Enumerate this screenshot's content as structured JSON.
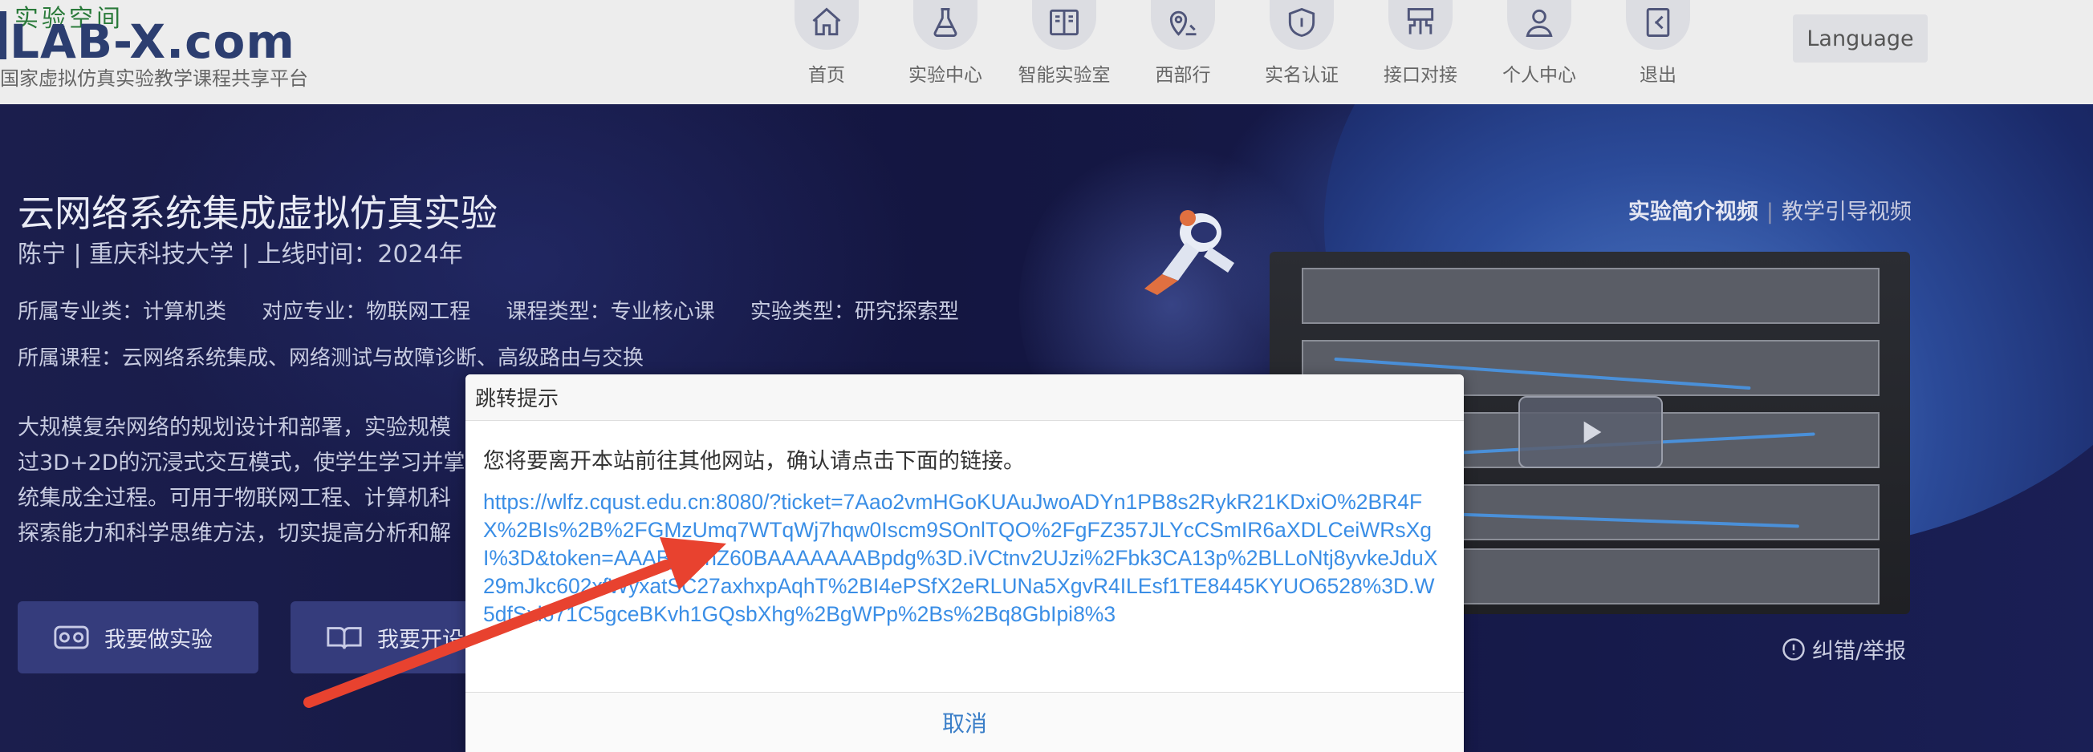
{
  "header": {
    "logo_top": "实验空间",
    "logo_main": "LAB-X.com",
    "logo_sub": "国家虚拟仿真实验教学课程共享平台",
    "nav": [
      {
        "label": "首页",
        "icon": "home-icon"
      },
      {
        "label": "实验中心",
        "icon": "flask-icon"
      },
      {
        "label": "智能实验室",
        "icon": "book-icon"
      },
      {
        "label": "西部行",
        "icon": "map-pin-icon"
      },
      {
        "label": "实名认证",
        "icon": "shield-icon"
      },
      {
        "label": "接口对接",
        "icon": "interface-icon"
      },
      {
        "label": "个人中心",
        "icon": "user-icon"
      },
      {
        "label": "退出",
        "icon": "logout-icon"
      }
    ],
    "language_label": "Language"
  },
  "experiment": {
    "title": "云网络系统集成虚拟仿真实验",
    "meta": "陈宁 | 重庆科技大学 | 上线时间：2024年",
    "tags": [
      "所属专业类：计算机类",
      "对应专业：物联网工程",
      "课程类型：专业核心课",
      "实验类型：研究探索型"
    ],
    "courses": "所属课程：云网络系统集成、网络测试与故障诊断、高级路由与交换",
    "description_lines": [
      "大规模复杂网络的规划设计和部署，实验规模",
      "过3D+2D的沉浸式交互模式，使学生学习并掌",
      "统集成全过程。可用于物联网工程、计算机科",
      "探索能力和科学思维方法，切实提高分析和解"
    ],
    "btn_do": "我要做实验",
    "btn_open": "我要开设"
  },
  "video": {
    "intro_label": "实验简介视频",
    "separator": "|",
    "guide_label": "教学引导视频",
    "report_label": "纠错/举报"
  },
  "modal": {
    "title": "跳转提示",
    "message": "您将要离开本站前往其他网站，确认请点击下面的链接。",
    "link": "https://wlfz.cqust.edu.cn:8080/?ticket=7Aao2vmHGoKUAuJwoADYn1PB8s2RykR21KDxiO%2BR4FX%2BIs%2B%2FGMzUmq7WTqWj7hqw0Iscm9SOnlTQO%2FgFZ357JLYcCSmIR6aXDLCeiWRsXgI%3D&token=AAABjhmhZ60BAAAAAAABpdg%3D.iVCtnv2UJzi%2Fbk3CA13p%2BLLoNtj8yvkeJduX29mJkc602xfWyxatSC27axhxpAqhT%2BI4ePSfX2eRLUNa5XgvR4ILEsf1TE8445KYUO6528%3D.W5dfSxl671C5gceBKvh1GQsbXhg%2BgWPp%2Bs%2Bq8GbIpi8%3",
    "cancel_label": "取消"
  },
  "colors": {
    "link": "#3a8ee6",
    "cancel": "#3a7ec8",
    "arrow": "#e8422f",
    "hero_bg": "#15163a"
  }
}
